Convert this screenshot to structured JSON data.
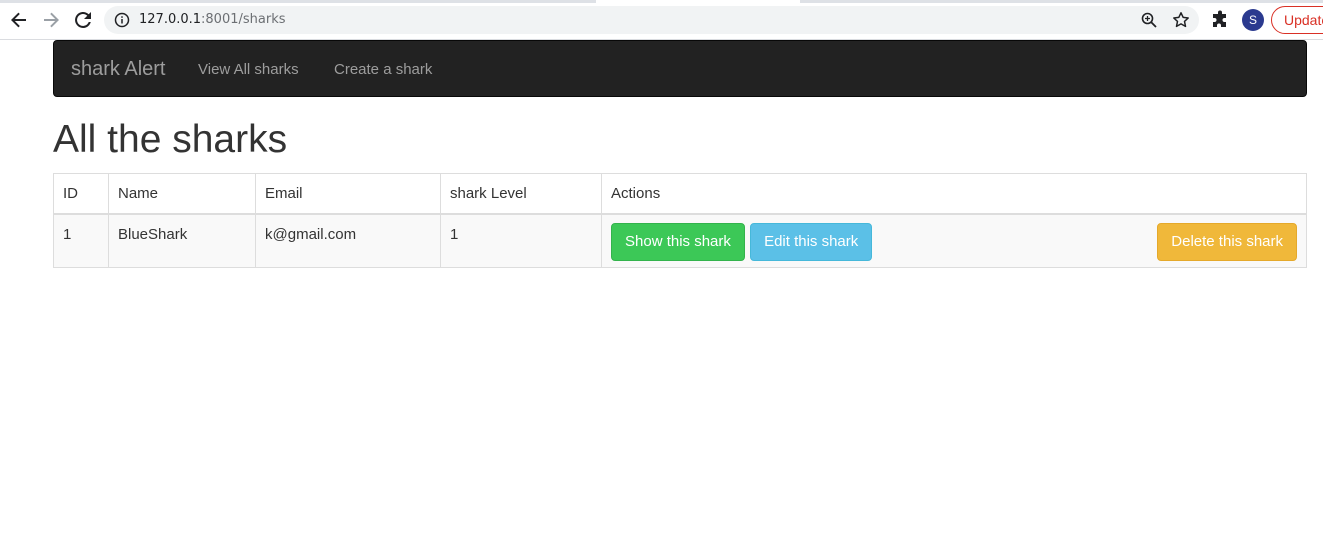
{
  "browser": {
    "url_host": "127.0.0.1",
    "url_path": ":8001/sharks",
    "profile_initial": "S",
    "update_label": "Update"
  },
  "navbar": {
    "brand": "shark Alert",
    "links": [
      "View All sharks",
      "Create a shark"
    ]
  },
  "page": {
    "title": "All the sharks"
  },
  "table": {
    "headers": [
      "ID",
      "Name",
      "Email",
      "shark Level",
      "Actions"
    ],
    "rows": [
      {
        "id": "1",
        "name": "BlueShark",
        "email": "k@gmail.com",
        "level": "1",
        "actions": {
          "show": "Show this shark",
          "edit": "Edit this shark",
          "delete": "Delete this shark"
        }
      }
    ]
  },
  "colors": {
    "navbar_bg": "#222222",
    "show_button": "#3cc857",
    "edit_button": "#5bc0e7",
    "delete_button": "#f0b83a",
    "update_pill": "#d93025"
  }
}
